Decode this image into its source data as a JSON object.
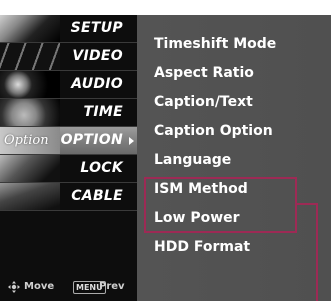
{
  "menu": {
    "items": [
      {
        "label": "SETUP",
        "thumb_icon": "setup-icon"
      },
      {
        "label": "VIDEO",
        "thumb_icon": "film-icon"
      },
      {
        "label": "AUDIO",
        "thumb_icon": "speaker-icon"
      },
      {
        "label": "TIME",
        "thumb_icon": "clock-icon"
      },
      {
        "label": "OPTION",
        "thumb_icon": "option-icon",
        "thumb_text": "Option"
      },
      {
        "label": "LOCK",
        "thumb_icon": "lock-icon"
      },
      {
        "label": "CABLE",
        "thumb_icon": "cable-icon"
      }
    ],
    "active": "OPTION"
  },
  "nav_hint": {
    "move_label": "Move",
    "menu_key": "MENU",
    "prev_label": "Prev"
  },
  "submenu": {
    "items": [
      "Timeshift Mode",
      "Aspect Ratio",
      "Caption/Text",
      "Caption Option",
      "Language",
      "ISM Method",
      "Low Power",
      "HDD Format"
    ],
    "highlighted": [
      "ISM Method",
      "Low Power"
    ]
  },
  "colors": {
    "menu_bg": "#0d0d0d",
    "submenu_bg": "#545454",
    "highlight": "#9d2a55",
    "text": "#ffffff"
  }
}
